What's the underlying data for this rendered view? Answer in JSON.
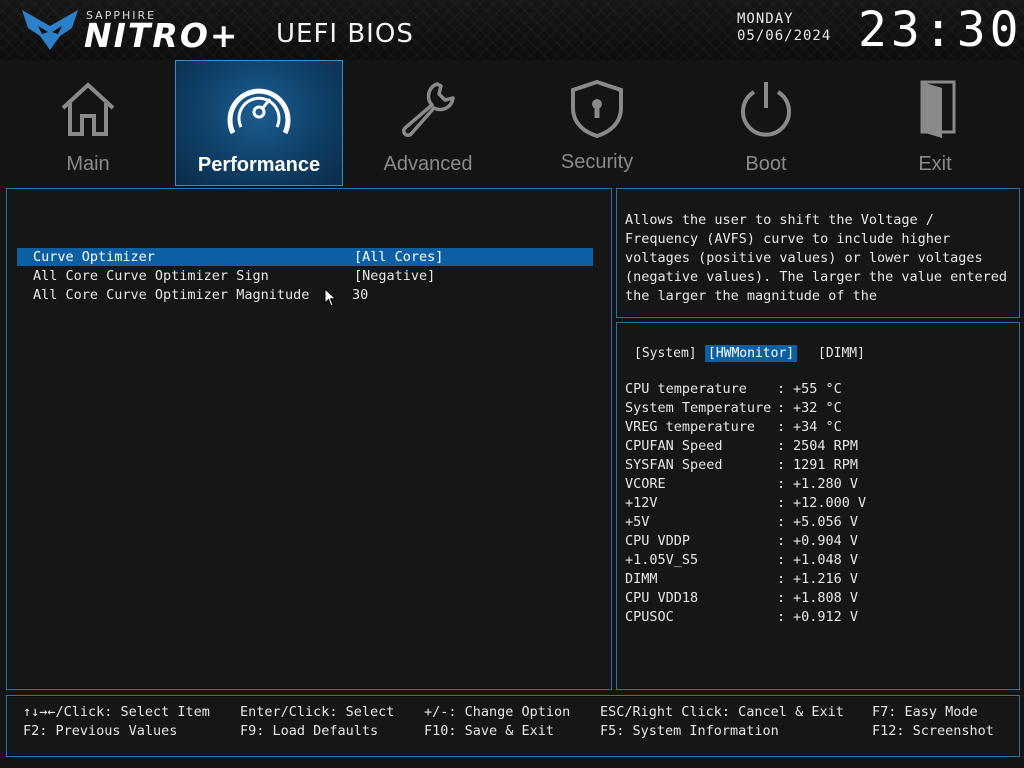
{
  "header": {
    "brand_small": "SAPPHIRE",
    "brand_big": "NITRO+",
    "title": "UEFI BIOS",
    "day": "MONDAY",
    "date": "05/06/2024",
    "time": "23:30"
  },
  "nav": [
    {
      "label": "Main",
      "icon": "home-icon"
    },
    {
      "label": "Performance",
      "icon": "speedometer-icon"
    },
    {
      "label": "Advanced",
      "icon": "wrench-icon"
    },
    {
      "label": "Security",
      "icon": "shield-lock-icon"
    },
    {
      "label": "Boot",
      "icon": "power-icon"
    },
    {
      "label": "Exit",
      "icon": "door-icon"
    }
  ],
  "settings": [
    {
      "label": "Curve Optimizer",
      "value": "[All Cores]"
    },
    {
      "label": "All Core Curve Optimizer Sign",
      "value": "[Negative]"
    },
    {
      "label": "All Core Curve Optimizer Magnitude",
      "value": "30"
    }
  ],
  "help": {
    "text": "Allows the user to shift the Voltage / Frequency (AVFS) curve to include higher voltages (positive values) or lower voltages (negative values). The larger the value entered the larger the magnitude of the"
  },
  "monitor": {
    "tabs": [
      "[System]",
      "[HWMonitor]",
      "[DIMM]"
    ],
    "rows": [
      {
        "label": "CPU temperature",
        "value": "+55 °C"
      },
      {
        "label": "System Temperature",
        "value": "+32 °C"
      },
      {
        "label": "VREG temperature",
        "value": "+34 °C"
      },
      {
        "label": "CPUFAN Speed",
        "value": "2504 RPM"
      },
      {
        "label": "SYSFAN Speed",
        "value": "1291 RPM"
      },
      {
        "label": "VCORE",
        "value": "+1.280 V"
      },
      {
        "label": "+12V",
        "value": "+12.000 V"
      },
      {
        "label": "+5V",
        "value": "+5.056 V"
      },
      {
        "label": "CPU VDDP",
        "value": "+0.904 V"
      },
      {
        "label": "+1.05V_S5",
        "value": "+1.048 V"
      },
      {
        "label": "DIMM",
        "value": "+1.216 V"
      },
      {
        "label": "CPU VDD18",
        "value": "+1.808 V"
      },
      {
        "label": "CPUSOC",
        "value": "+0.912 V"
      }
    ],
    "separator": ":"
  },
  "footer": {
    "row1": [
      "↑↓→←/Click: Select Item",
      "Enter/Click: Select",
      "+/-: Change Option",
      "ESC/Right Click: Cancel & Exit",
      "F7: Easy Mode"
    ],
    "row2": [
      "F2: Previous Values",
      "F9: Load Defaults",
      "F10: Save & Exit",
      "F5: System Information",
      "F12: Screenshot"
    ]
  },
  "colors": {
    "accent": "#2e8fd2",
    "selection": "#0d5fa3",
    "background": "#141414"
  }
}
